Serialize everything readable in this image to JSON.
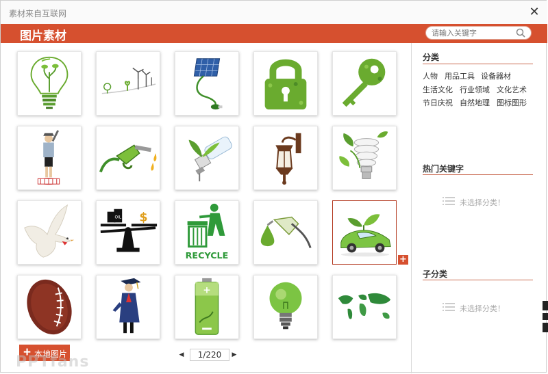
{
  "window": {
    "source_label": "素材来自互联网",
    "close_icon": "close-icon"
  },
  "header": {
    "title": "图片素材"
  },
  "search": {
    "placeholder": "请输入关键字",
    "icon": "search-icon"
  },
  "grid": {
    "items": [
      {
        "name": "lightbulb-with-plant"
      },
      {
        "name": "wind-turbines"
      },
      {
        "name": "solar-panel-plug"
      },
      {
        "name": "leaf-padlock"
      },
      {
        "name": "leaf-key"
      },
      {
        "name": "traffic-officer"
      },
      {
        "name": "fuel-nozzle"
      },
      {
        "name": "cfl-bulb-plant"
      },
      {
        "name": "street-lamp"
      },
      {
        "name": "spiral-bulb-leaves"
      },
      {
        "name": "white-dove"
      },
      {
        "name": "oil-vs-dollar-scale"
      },
      {
        "name": "recycle-bin-figure"
      },
      {
        "name": "green-fuel-nozzle-drop"
      },
      {
        "name": "eco-car",
        "selected": true
      },
      {
        "name": "football"
      },
      {
        "name": "graduate"
      },
      {
        "name": "green-battery"
      },
      {
        "name": "green-lightbulb"
      },
      {
        "name": "green-world-map"
      }
    ]
  },
  "local_button": {
    "label": "本地图片"
  },
  "watermark": "PPTfans",
  "pager": {
    "current": "1/220"
  },
  "sidebar": {
    "category": {
      "title": "分类",
      "items": [
        "人物",
        "用品工具",
        "设备器材",
        "生活文化",
        "行业领域",
        "文化艺术",
        "节日庆祝",
        "自然地理",
        "图标图形"
      ]
    },
    "hot_keywords": {
      "title": "热门关键字",
      "empty_text": "未选择分类！"
    },
    "subcategory": {
      "title": "子分类",
      "empty_text": "未选择分类！"
    }
  },
  "colors": {
    "accent": "#d6502f",
    "leaf_green": "#5a9e2f"
  }
}
